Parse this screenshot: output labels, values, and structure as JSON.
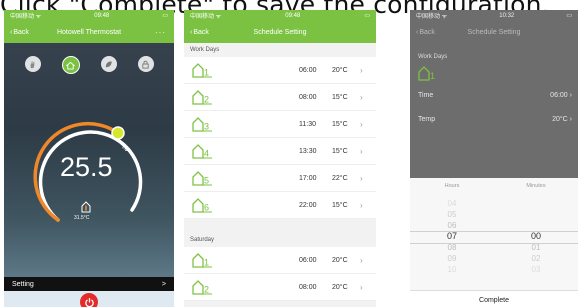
{
  "caption": "Click \"Complete\" to save the configuration.",
  "phone1": {
    "status_left": "中国移动 ᯤ",
    "status_time": "09:48",
    "back": "Back",
    "title": "Hotowell Thermostat",
    "more": "···",
    "set_temp": "25.5",
    "unit": "°C",
    "room_temp": "31.5°C",
    "setting_label": "Setting",
    "setting_chevron": ">",
    "dial_level": 0.72
  },
  "phone2": {
    "status_left": "中国移动 ᯤ",
    "status_time": "09:48",
    "back": "Back",
    "title": "Schedule Setting",
    "workdays_label": "Work Days",
    "saturday_label": "Saturday",
    "workdays": [
      {
        "period": "1",
        "time": "06:00",
        "temp": "20°C"
      },
      {
        "period": "2",
        "time": "08:00",
        "temp": "15°C"
      },
      {
        "period": "3",
        "time": "11:30",
        "temp": "15°C"
      },
      {
        "period": "4",
        "time": "13:30",
        "temp": "15°C"
      },
      {
        "period": "5",
        "time": "17:00",
        "temp": "22°C"
      },
      {
        "period": "6",
        "time": "22:00",
        "temp": "15°C"
      }
    ],
    "saturday": [
      {
        "period": "1",
        "time": "06:00",
        "temp": "20°C"
      },
      {
        "period": "2",
        "time": "08:00",
        "temp": "20°C"
      }
    ]
  },
  "phone3": {
    "status_left": "中国移动 ᯤ",
    "status_time": "10:32",
    "back": "Back",
    "title": "Schedule Setting",
    "section": "Work Days",
    "period": "1",
    "time_label": "Time",
    "time_value": "06:00",
    "temp_label": "Temp",
    "temp_value": "20°C",
    "hours_label": "Hours",
    "minutes_label": "Minutes",
    "hours": [
      "04",
      "05",
      "06",
      "07",
      "08",
      "09",
      "10"
    ],
    "minutes": [
      "",
      "",
      "",
      "00",
      "01",
      "02",
      "03"
    ],
    "selected_index": 3,
    "complete": "Complete"
  },
  "colors": {
    "accent": "#7cc242",
    "power": "#e32b2b",
    "dial_orange": "#f0882a",
    "dial_yellow": "#d5e82b"
  }
}
